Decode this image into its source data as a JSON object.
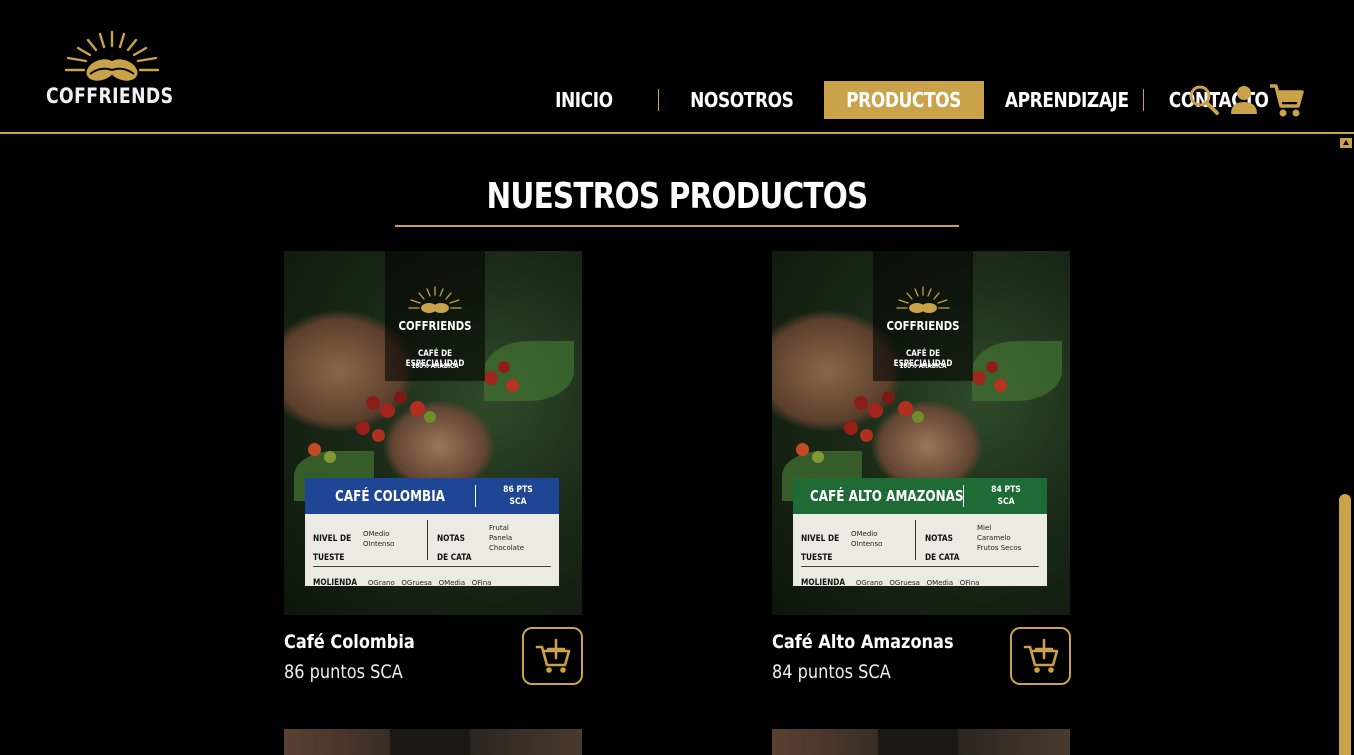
{
  "header": {
    "brand": "COFFRIENDS",
    "nav": [
      {
        "label": "INICIO",
        "active": false
      },
      {
        "label": "NOSOTROS",
        "active": false
      },
      {
        "label": "PRODUCTOS",
        "active": true
      },
      {
        "label": "APRENDIZAJE",
        "active": false
      },
      {
        "label": "CONTACTO",
        "active": false
      }
    ],
    "icons": [
      "search-icon",
      "user-icon",
      "cart-icon"
    ]
  },
  "colors": {
    "accent": "#c9a24a",
    "background": "#000000",
    "colombia_band": "#1f4595",
    "amazonas_band": "#1e6b35"
  },
  "section": {
    "title": "NUESTROS PRODUCTOS"
  },
  "products": [
    {
      "label_brand": "COFFRIENDS",
      "label_subtitle": "CAFÉ DE ESPECIALIDAD",
      "label_subtitle2": "100% ARÁBICA",
      "tag_name": "CAFÉ COLOMBIA",
      "tag_pts_line1": "86 PTS",
      "tag_pts_line2": "SCA",
      "tag_roast_key_line1": "NIVEL DE",
      "tag_roast_key_line2": "TUESTE",
      "tag_roast_options_line1": "OMedio",
      "tag_roast_options_line2": "OIntenso",
      "tag_notes_key_line1": "NOTAS",
      "tag_notes_key_line2": "DE CATA",
      "tag_notes": [
        "Frutal",
        "Panela",
        "Chocolate"
      ],
      "tag_grind_key": "MOLIENDA",
      "tag_grind_options": "OGrano   OGruesa   OMedia   OFina",
      "name": "Café Colombia",
      "points": "86 puntos SCA"
    },
    {
      "label_brand": "COFFRIENDS",
      "label_subtitle": "CAFÉ DE ESPECIALIDAD",
      "label_subtitle2": "100% ARÁBICA",
      "tag_name": "CAFÉ ALTO AMAZONAS",
      "tag_pts_line1": "84 PTS",
      "tag_pts_line2": "SCA",
      "tag_roast_key_line1": "NIVEL DE",
      "tag_roast_key_line2": "TUESTE",
      "tag_roast_options_line1": "OMedio",
      "tag_roast_options_line2": "OIntenso",
      "tag_notes_key_line1": "NOTAS",
      "tag_notes_key_line2": "DE CATA",
      "tag_notes": [
        "Miel",
        "Caramelo",
        "Frutos Secos"
      ],
      "tag_grind_key": "MOLIENDA",
      "tag_grind_options": "OGrano   OGruesa   OMedia   OFina",
      "name": "Café Alto Amazonas",
      "points": "84 puntos SCA"
    }
  ]
}
